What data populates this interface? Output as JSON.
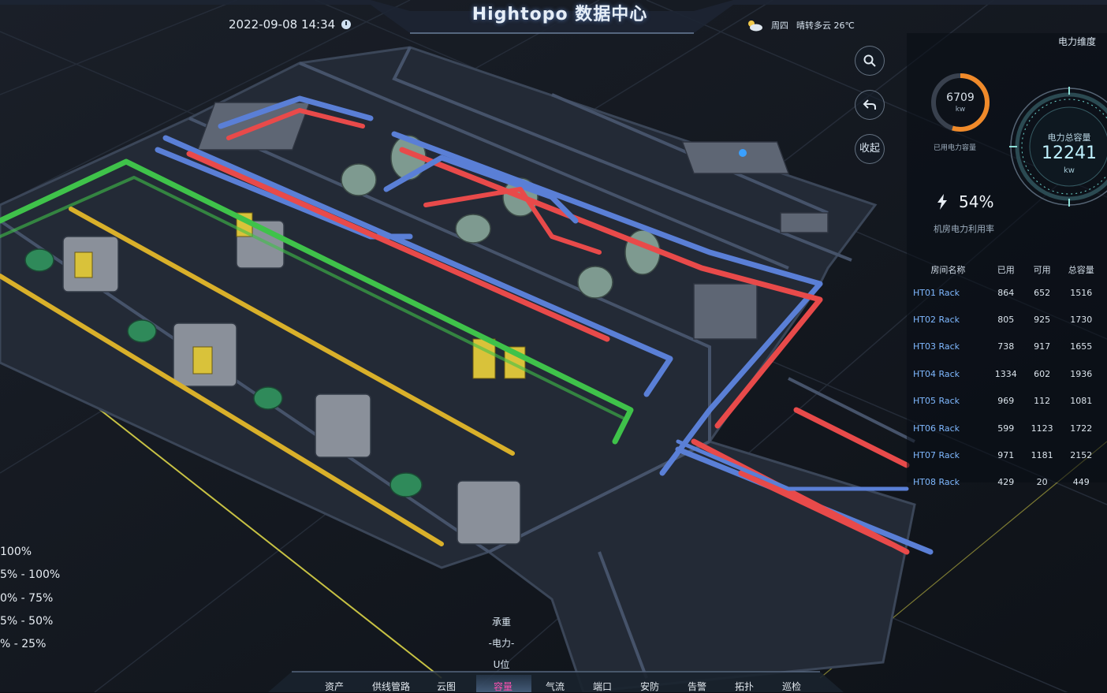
{
  "header": {
    "title": "Hightopo 数据中心",
    "datetime": "2022-09-08 14:34",
    "weather": {
      "day": "周四",
      "text": "晴转多云 26℃",
      "icon": "cloud-sun-icon"
    }
  },
  "tools": [
    {
      "name": "search-tool-button",
      "icon": "search-icon",
      "label": ""
    },
    {
      "name": "back-tool-button",
      "icon": "back-arrow-icon",
      "label": ""
    },
    {
      "name": "collapse-tool-button",
      "icon": "",
      "label": "收起"
    }
  ],
  "power_panel": {
    "title": "电力维度",
    "used": {
      "value": "6709",
      "unit": "kw",
      "label": "已用电力容量",
      "fraction": 0.547
    },
    "total": {
      "label": "电力总容量",
      "value": "12241",
      "unit": "kw"
    },
    "utilization": {
      "value": "54%",
      "label": "机房电力利用率",
      "icon": "lightning-icon"
    },
    "table": {
      "headers": [
        "房间名称",
        "已用",
        "可用",
        "总容量"
      ],
      "rows": [
        [
          "HT01 Rack",
          "864",
          "652",
          "1516"
        ],
        [
          "HT02 Rack",
          "805",
          "925",
          "1730"
        ],
        [
          "HT03 Rack",
          "738",
          "917",
          "1655"
        ],
        [
          "HT04 Rack",
          "1334",
          "602",
          "1936"
        ],
        [
          "HT05 Rack",
          "969",
          "112",
          "1081"
        ],
        [
          "HT06 Rack",
          "599",
          "1123",
          "1722"
        ],
        [
          "HT07 Rack",
          "971",
          "1181",
          "2152"
        ],
        [
          "HT08 Rack",
          "429",
          "20",
          "449"
        ]
      ]
    }
  },
  "legend": [
    "100%",
    "5% - 100%",
    "0% - 75%",
    "5% - 50%",
    "% - 25%"
  ],
  "sub_menu": [
    "承重",
    "-电力-",
    "U位"
  ],
  "nav": {
    "items": [
      "资产",
      "供线管路",
      "云图",
      "容量",
      "气流",
      "端口",
      "安防",
      "告警",
      "拓扑",
      "巡检"
    ],
    "active": "容量"
  },
  "colors": {
    "accent": "#3aa0ff",
    "active_nav": "#ff4fb0",
    "pipe_red": "#e84a4a",
    "pipe_blue": "#5a7fd6",
    "pipe_green": "#3fc24a",
    "pipe_yellow": "#d9b02a"
  }
}
